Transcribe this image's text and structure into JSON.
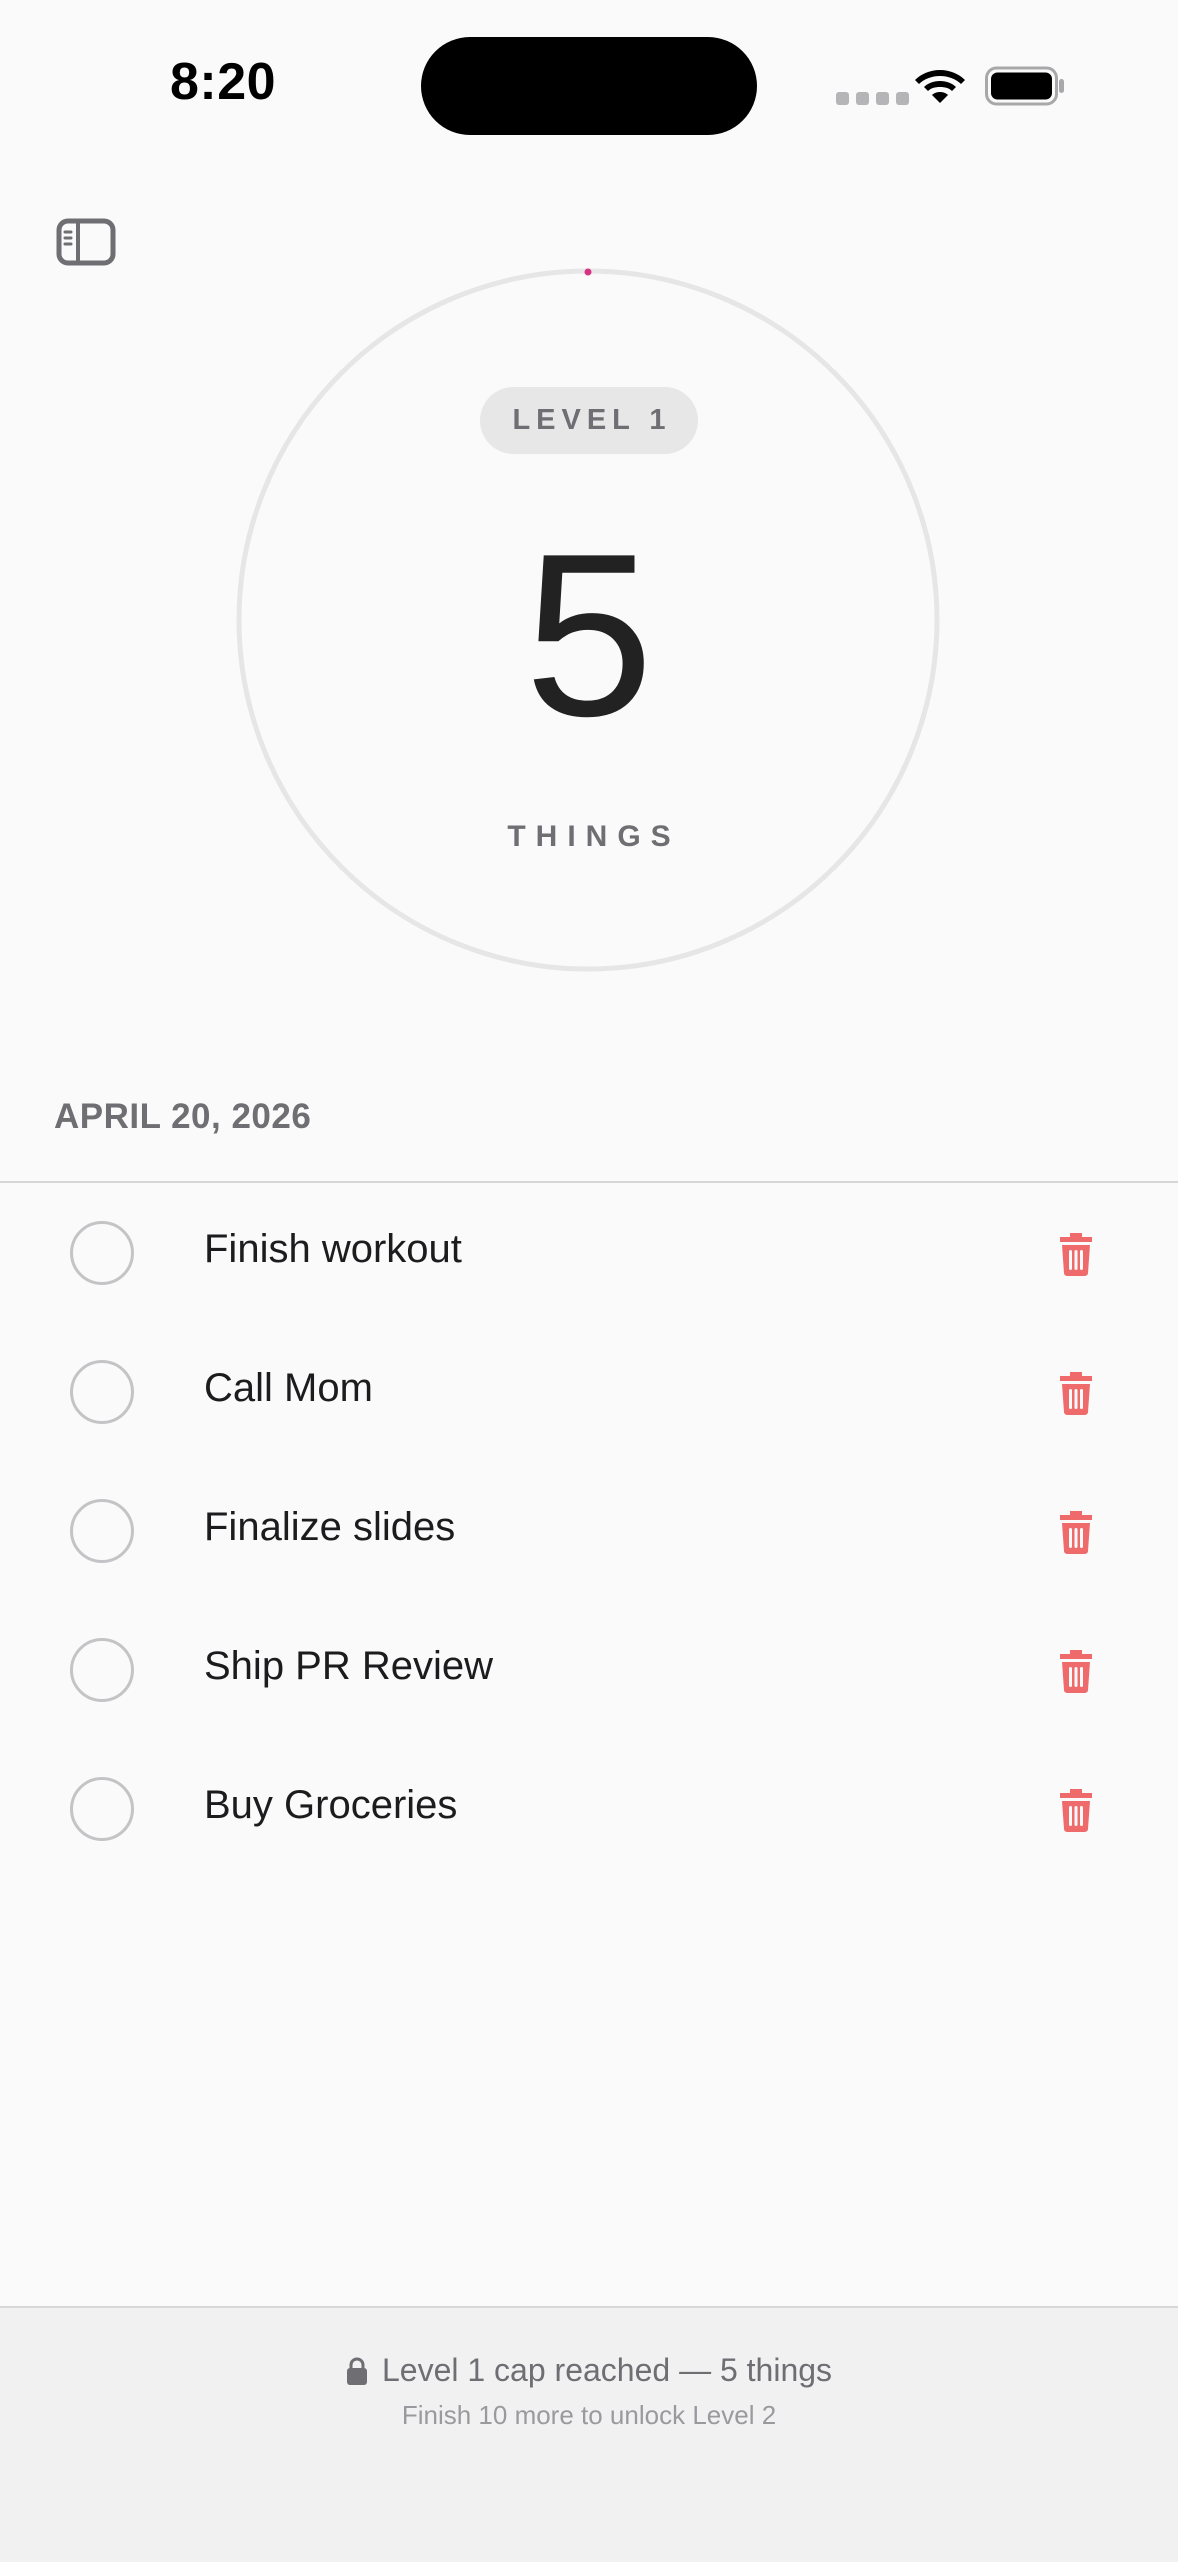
{
  "status_bar": {
    "time": "8:20"
  },
  "header": {
    "sidebar_toggle_icon": "sidebar-icon"
  },
  "progress": {
    "level_label": "LEVEL 1",
    "count": "5",
    "unit": "THINGS",
    "ring_fill_fraction": 0.0,
    "accent_color": "#d63384"
  },
  "list": {
    "date_header": "APRIL 20, 2026",
    "tasks": [
      {
        "label": "Finish workout",
        "done": false
      },
      {
        "label": "Call Mom",
        "done": false
      },
      {
        "label": "Finalize slides",
        "done": false
      },
      {
        "label": "Ship PR Review",
        "done": false
      },
      {
        "label": "Buy Groceries",
        "done": false
      }
    ],
    "delete_icon": "trash-icon",
    "delete_color": "#ef6b6b"
  },
  "footer": {
    "cap_text": "Level 1 cap reached — 5 things",
    "unlock_text": "Finish 10 more to unlock Level 2",
    "lock_icon": "lock-icon"
  }
}
